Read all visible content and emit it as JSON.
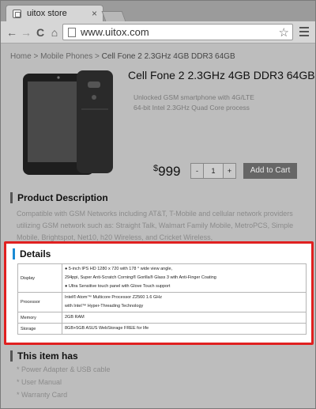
{
  "browser": {
    "tab_title": "uitox store",
    "tab_close": "×",
    "url": "www.uitox.com",
    "back_icon": "←",
    "forward_icon": "→",
    "reload_icon": "C",
    "home_icon": "⌂",
    "star_icon": "☆"
  },
  "breadcrumb": {
    "home": "Home",
    "sep1": " > ",
    "category": "Mobile Phones",
    "sep2": " > ",
    "current": "Cell Fone 2 2.3GHz 4GB DDR3 64GB"
  },
  "product": {
    "title": "Cell Fone 2 2.3GHz 4GB DDR3 64GB",
    "subtitle_line1": "Unlocked GSM smartphone with 4G/LTE",
    "subtitle_line2": "64-bit Intel 2.3GHz Quad Core process",
    "currency": "$",
    "price": "999",
    "qty_minus": "-",
    "qty_value": "1",
    "qty_plus": "+",
    "add_to_cart": "Add to Cart"
  },
  "description": {
    "heading": "Product Description",
    "text": "Compatible with GSM Networks including AT&T, T-Mobile and cellular network providers utilizing GSM network such as: Straight Talk, Walmart Family Mobile, MetroPCS, Simple Mobile, Brightspot, Net10, h20 Wireless, and Cricket Wireless,"
  },
  "details": {
    "heading": "Details",
    "rows": [
      {
        "key": "Display",
        "lines": [
          "●  5-inch IPS HD 1280 x 720 with 178 ° wide view angle,",
          "294ppi, Super Anti-Scratch Corning® Gorilla® Glass 3 with Anti-Finger Coating",
          "●  Ultra Sensitive touch panel with Glove Touch support"
        ]
      },
      {
        "key": "Processor",
        "lines": [
          "Intel® Atom™ Multicore Processor Z2560  1.6 GHz",
          "with Intel™ Hyper-Threading Technology"
        ]
      },
      {
        "key": "Memory",
        "lines": [
          "2GB   RAM"
        ]
      },
      {
        "key": "Storage",
        "lines": [
          "8GB+5GB ASUS WebStorage FREE for life"
        ]
      }
    ]
  },
  "included": {
    "heading": "This item has",
    "items": [
      "* Power Adapter & USB cable",
      "* User Manual",
      "* Warranty Card"
    ]
  }
}
